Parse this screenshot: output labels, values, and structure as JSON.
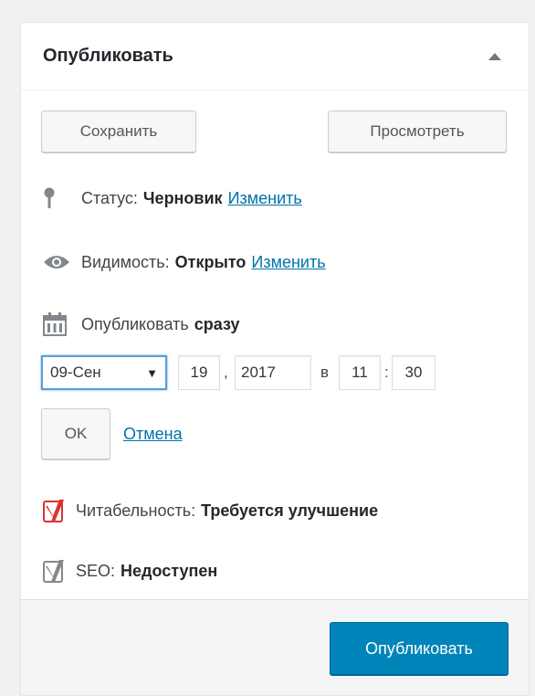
{
  "panel": {
    "title": "Опубликовать"
  },
  "actions": {
    "save_label": "Сохранить",
    "preview_label": "Просмотреть"
  },
  "status": {
    "label": "Статус:",
    "value": "Черновик",
    "edit_link": "Изменить"
  },
  "visibility": {
    "label": "Видимость:",
    "value": "Открыто",
    "edit_link": "Изменить"
  },
  "schedule": {
    "label": "Опубликовать",
    "value": "сразу",
    "month": "09-Сен",
    "day": "19",
    "comma": ",",
    "year": "2017",
    "at": "в",
    "hour": "11",
    "colon": ":",
    "minute": "30",
    "ok_label": "OK",
    "cancel_link": "Отмена"
  },
  "readability": {
    "label": "Читабельность:",
    "value": "Требуется улучшение",
    "color": "#dc3232"
  },
  "seo": {
    "label": "SEO:",
    "value": "Недоступен",
    "color": "#888888"
  },
  "footer": {
    "publish_label": "Опубликовать"
  },
  "colors": {
    "primary": "#0085ba",
    "link": "#0073aa"
  }
}
